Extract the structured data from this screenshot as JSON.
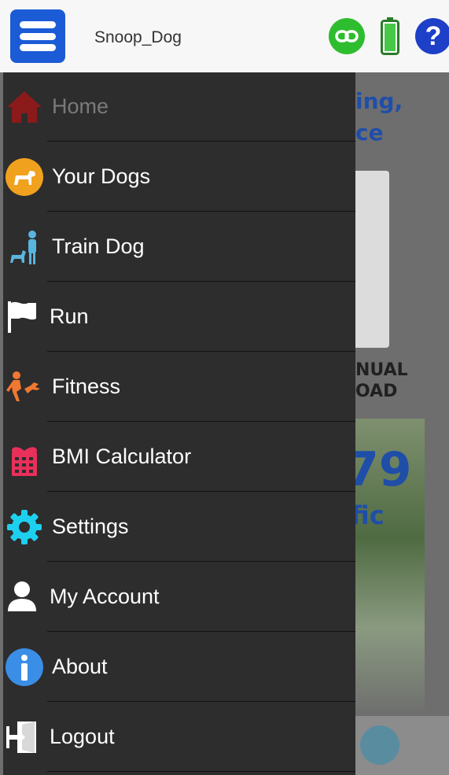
{
  "header": {
    "username": "Snoop_Dog",
    "icons": [
      "menu-icon",
      "link-icon",
      "battery-icon",
      "help-icon"
    ],
    "help_label": "?",
    "accent_color": "#1c5bd6"
  },
  "background": {
    "text1": "ing,",
    "text2": "ce",
    "text3": "NUAL",
    "text4": "OAD",
    "text5": "79",
    "text6": "fic"
  },
  "drawer": {
    "items": [
      {
        "label": "Home",
        "icon": "home-icon"
      },
      {
        "label": "Your Dogs",
        "icon": "dog-icon"
      },
      {
        "label": "Train Dog",
        "icon": "train-dog-icon"
      },
      {
        "label": "Run",
        "icon": "flag-icon"
      },
      {
        "label": "Fitness",
        "icon": "fitness-icon"
      },
      {
        "label": "BMI Calculator",
        "icon": "calculator-icon"
      },
      {
        "label": "Settings",
        "icon": "gear-icon"
      },
      {
        "label": "My Account",
        "icon": "user-icon"
      },
      {
        "label": "About",
        "icon": "info-icon"
      },
      {
        "label": "Logout",
        "icon": "logout-icon"
      }
    ]
  }
}
